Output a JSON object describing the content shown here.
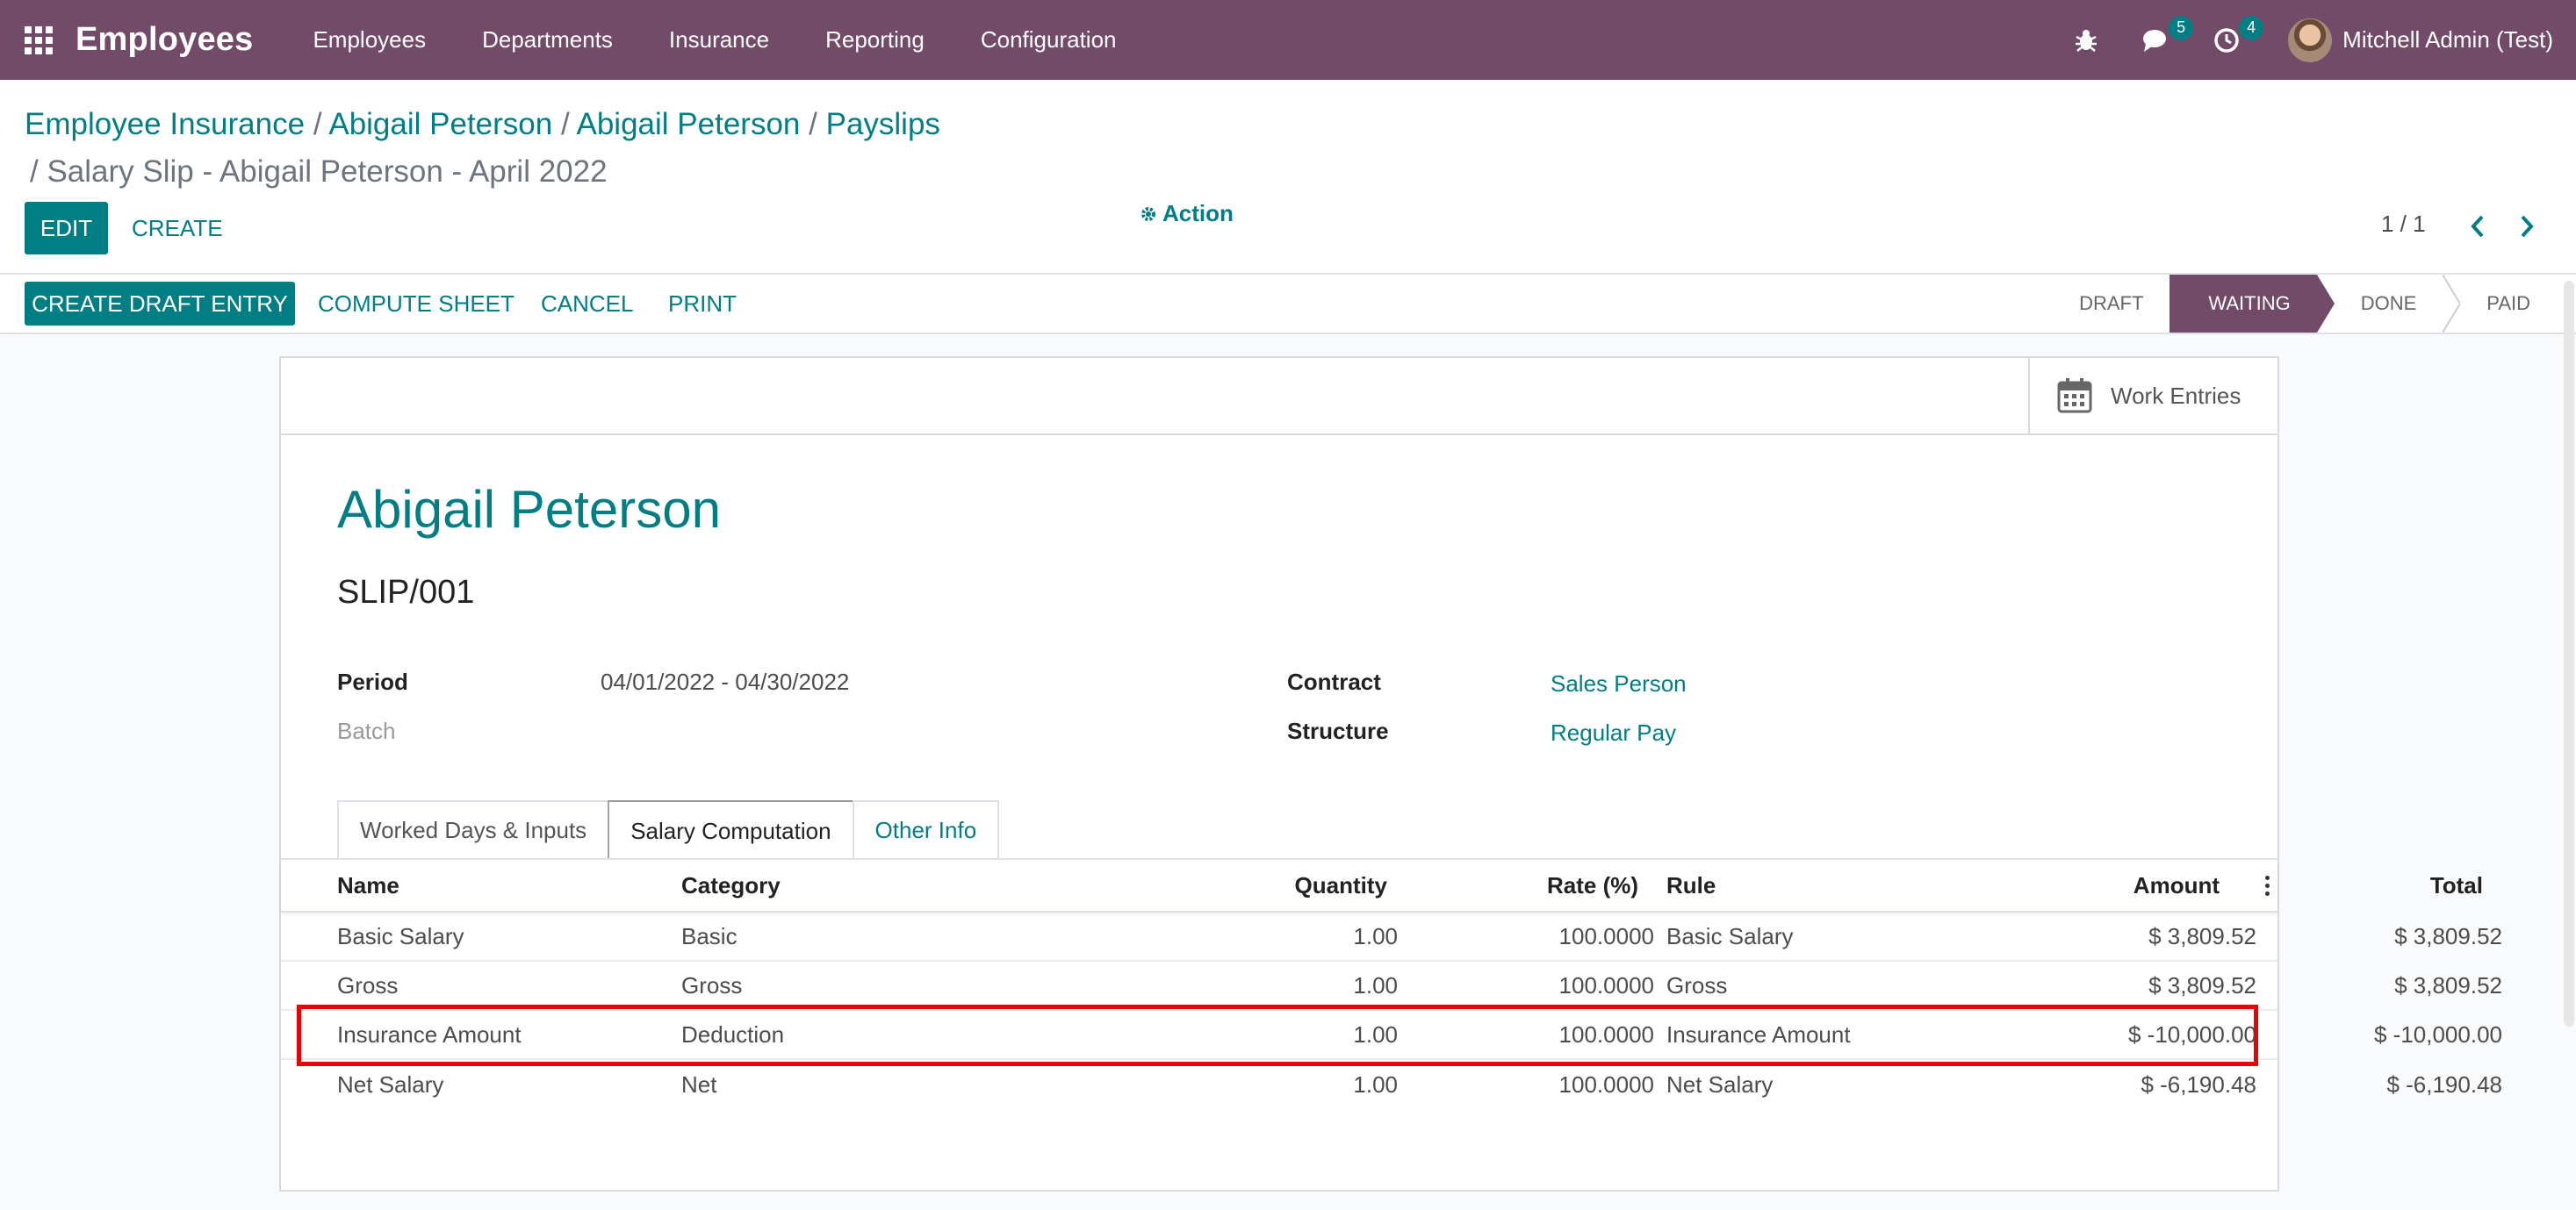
{
  "navbar": {
    "app_title": "Employees",
    "menu": [
      "Employees",
      "Departments",
      "Insurance",
      "Reporting",
      "Configuration"
    ],
    "messages_count": "5",
    "activities_count": "4",
    "user_name": "Mitchell Admin (Test)",
    "color": "#714b67"
  },
  "breadcrumb": {
    "items": [
      "Employee Insurance",
      "Abigail Peterson",
      "Abigail Peterson",
      "Payslips"
    ],
    "separator": "/",
    "current": "/ Salary Slip - Abigail Peterson - April 2022"
  },
  "buttons": {
    "edit": "EDIT",
    "create": "CREATE",
    "action": "Action",
    "create_draft_entry": "CREATE DRAFT ENTRY",
    "compute_sheet": "COMPUTE SHEET",
    "cancel": "CANCEL",
    "print": "PRINT"
  },
  "pager": "1 / 1",
  "stages": [
    "DRAFT",
    "WAITING",
    "DONE",
    "PAID"
  ],
  "active_stage": "WAITING",
  "smart_button": "Work Entries",
  "form": {
    "employee": "Abigail Peterson",
    "reference": "SLIP/001",
    "period_label": "Period",
    "period_value": "04/01/2022 - 04/30/2022",
    "batch_label": "Batch",
    "contract_label": "Contract",
    "contract_value": "Sales Person",
    "structure_label": "Structure",
    "structure_value": "Regular Pay"
  },
  "tabs": [
    "Worked Days & Inputs",
    "Salary Computation",
    "Other Info"
  ],
  "active_tab": "Salary Computation",
  "table": {
    "headers": [
      "Name",
      "Category",
      "Quantity",
      "Rate (%)",
      "Rule",
      "Amount",
      "Total"
    ],
    "rows": [
      [
        "Basic Salary",
        "Basic",
        "1.00",
        "100.0000",
        "Basic Salary",
        "$ 3,809.52",
        "$ 3,809.52"
      ],
      [
        "Gross",
        "Gross",
        "1.00",
        "100.0000",
        "Gross",
        "$ 3,809.52",
        "$ 3,809.52"
      ],
      [
        "Insurance Amount",
        "Deduction",
        "1.00",
        "100.0000",
        "Insurance Amount",
        "$ -10,000.00",
        "$ -10,000.00"
      ],
      [
        "Net Salary",
        "Net",
        "1.00",
        "100.0000",
        "Net Salary",
        "$ -6,190.48",
        "$ -6,190.48"
      ]
    ],
    "highlighted_row": "Insurance Amount"
  },
  "colors": {
    "accent": "#017e84",
    "brand": "#714b67",
    "highlight": "#ee0000"
  }
}
